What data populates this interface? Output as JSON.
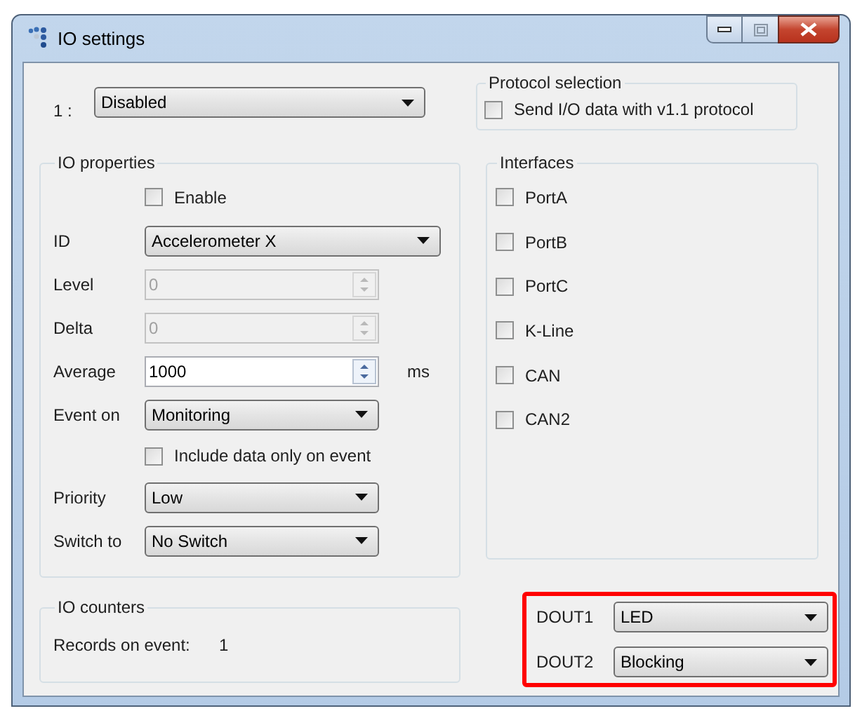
{
  "window": {
    "title": "IO settings"
  },
  "io_selector": {
    "label": "1 :",
    "value": "Disabled"
  },
  "protocol_selection": {
    "title": "Protocol selection",
    "checkbox": {
      "label": "Send I/O data with v1.1 protocol",
      "checked": false
    }
  },
  "io_properties": {
    "title": "IO properties",
    "rows": [
      {
        "kind": "checkbox",
        "label": "Enable",
        "checked": false
      },
      {
        "kind": "dropdown",
        "label": "ID",
        "value": "Accelerometer X",
        "wide": true
      },
      {
        "kind": "spinner",
        "label": "Level",
        "value": "0",
        "disabled": true
      },
      {
        "kind": "spinner",
        "label": "Delta",
        "value": "0",
        "disabled": true
      },
      {
        "kind": "spinner",
        "label": "Average",
        "value": "1000",
        "disabled": false,
        "unit": "ms"
      },
      {
        "kind": "dropdown",
        "label": "Event on",
        "value": "Monitoring",
        "wide": false
      },
      {
        "kind": "checkbox",
        "label": "Include data only on event",
        "checked": false
      },
      {
        "kind": "dropdown",
        "label": "Priority",
        "value": "Low",
        "wide": false
      },
      {
        "kind": "dropdown",
        "label": "Switch to",
        "value": "No Switch",
        "wide": false
      }
    ]
  },
  "interfaces": {
    "title": "Interfaces",
    "items": [
      {
        "label": "PortA",
        "checked": false
      },
      {
        "label": "PortB",
        "checked": false
      },
      {
        "label": "PortC",
        "checked": false
      },
      {
        "label": "K-Line",
        "checked": false
      },
      {
        "label": "CAN",
        "checked": false
      },
      {
        "label": "CAN2",
        "checked": false
      }
    ]
  },
  "io_counters": {
    "title": "IO counters",
    "label": "Records on event:",
    "value": "1"
  },
  "digital_outputs": {
    "highlighted": true,
    "items": [
      {
        "label": "DOUT1",
        "value": "LED"
      },
      {
        "label": "DOUT2",
        "value": "Blocking"
      }
    ]
  }
}
